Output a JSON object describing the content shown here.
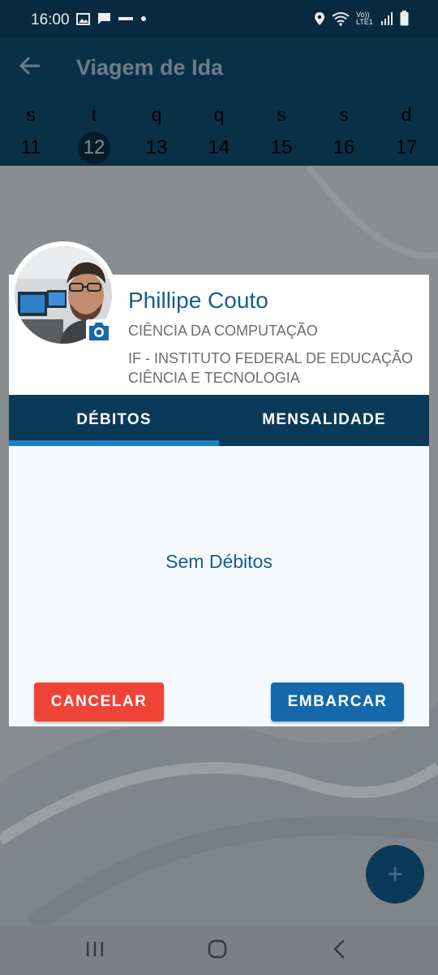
{
  "status_bar": {
    "time": "16:00",
    "left_icons": [
      "image-icon",
      "chat-icon",
      "network-icon",
      "dot-icon"
    ],
    "right_icons": [
      "location-icon",
      "wifi-icon",
      "volte-icon",
      "signal-icon",
      "battery-icon"
    ],
    "volte_label": "Vo)) LTE1"
  },
  "app_bar": {
    "title": "Viagem de Ida",
    "days": [
      {
        "letter": "s",
        "num": "11"
      },
      {
        "letter": "t",
        "num": "12"
      },
      {
        "letter": "q",
        "num": "13"
      },
      {
        "letter": "q",
        "num": "14"
      },
      {
        "letter": "s",
        "num": "15"
      },
      {
        "letter": "s",
        "num": "16"
      },
      {
        "letter": "d",
        "num": "17"
      }
    ],
    "selected_day": "12"
  },
  "dialog": {
    "name": "Phillipe Couto",
    "course": "CIÊNCIA DA COMPUTAÇÃO",
    "institution": "IF - INSTITUTO FEDERAL DE EDUCAÇÃO CIÊNCIA E TECNOLOGIA",
    "tabs": [
      {
        "label": "DÉBITOS",
        "active": true
      },
      {
        "label": "MENSALIDADE",
        "active": false
      }
    ],
    "empty_message": "Sem Débitos",
    "cancel_label": "CANCELAR",
    "confirm_label": "EMBARCAR"
  },
  "fab": {
    "icon": "plus-icon",
    "label": "+"
  },
  "colors": {
    "primary_dark": "#0b3a58",
    "accent_blue": "#1569ab",
    "text_blue": "#165d8e",
    "cancel_red": "#f04338",
    "tab_indicator": "#1f7fc4"
  }
}
